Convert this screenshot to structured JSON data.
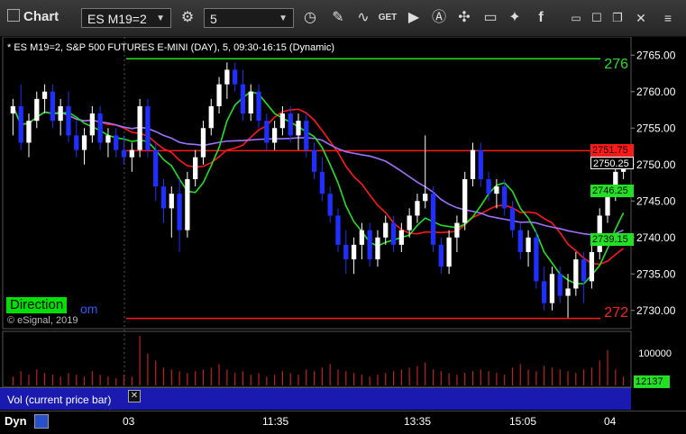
{
  "toolbar": {
    "title": "Chart",
    "symbol": "ES M19=2",
    "interval": "5"
  },
  "chart": {
    "header": "* ES M19=2, S&P 500 FUTURES E-MINI (DAY), 5, 09:30-16:15 (Dynamic)",
    "price_ticks": [
      "2765.00",
      "2760.00",
      "2755.00",
      "2750.00",
      "2745.00",
      "2740.00",
      "2735.00",
      "2730.00"
    ],
    "level_top_label": "276",
    "level_bottom_label": "272",
    "box_red_upper": "2751.75",
    "box_last": "2750.25",
    "box_green_mid": "2746.25",
    "box_green_low": "2739.15",
    "direction_label": "Direction",
    "watermark_suffix": "om",
    "copyright": "© eSignal, 2019",
    "volume_tick": "100000",
    "volume_last": "12137",
    "volume_label": "Vol (current price bar)",
    "x_ticks": [
      "03",
      "11:35",
      "13:35",
      "15:05",
      "04"
    ],
    "footer_mode": "Dyn",
    "colors": {
      "up": "#ffffff",
      "down": "#1f2fff",
      "ma_red": "#ff1a1a",
      "ma_green": "#22e022",
      "ma_purple": "#a070ff",
      "accent": "#00e000"
    }
  },
  "chart_data": {
    "type": "candlestick",
    "ylim": [
      2727.5,
      2767.5
    ],
    "candles": [
      [
        2757,
        2759,
        2754,
        2758
      ],
      [
        2758,
        2761,
        2752,
        2753
      ],
      [
        2753,
        2757,
        2751,
        2756
      ],
      [
        2756,
        2760,
        2755,
        2759
      ],
      [
        2759,
        2761,
        2757,
        2760
      ],
      [
        2760,
        2761,
        2755,
        2756
      ],
      [
        2756,
        2759,
        2754,
        2758
      ],
      [
        2758,
        2760,
        2753,
        2754
      ],
      [
        2754,
        2756,
        2751,
        2752
      ],
      [
        2752,
        2755,
        2750,
        2754
      ],
      [
        2754,
        2758,
        2753,
        2757
      ],
      [
        2757,
        2758,
        2752,
        2753
      ],
      [
        2753,
        2755,
        2751,
        2754
      ],
      [
        2754,
        2755,
        2751,
        2752
      ],
      [
        2752,
        2754,
        2750,
        2751
      ],
      [
        2751,
        2753,
        2749,
        2752
      ],
      [
        2752,
        2759,
        2751,
        2758
      ],
      [
        2758,
        2759,
        2751,
        2752
      ],
      [
        2752,
        2753,
        2745,
        2747
      ],
      [
        2747,
        2748,
        2742,
        2744
      ],
      [
        2744,
        2747,
        2740,
        2746
      ],
      [
        2746,
        2748,
        2738,
        2741
      ],
      [
        2741,
        2749,
        2740,
        2748
      ],
      [
        2748,
        2752,
        2747,
        2751
      ],
      [
        2751,
        2756,
        2750,
        2755
      ],
      [
        2755,
        2759,
        2754,
        2758
      ],
      [
        2758,
        2762,
        2757,
        2761
      ],
      [
        2761,
        2764,
        2759,
        2763
      ],
      [
        2763,
        2764,
        2760,
        2761
      ],
      [
        2761,
        2763,
        2756,
        2757
      ],
      [
        2757,
        2761,
        2756,
        2760
      ],
      [
        2760,
        2761,
        2755,
        2756
      ],
      [
        2756,
        2757,
        2752,
        2753
      ],
      [
        2753,
        2756,
        2752,
        2755
      ],
      [
        2755,
        2758,
        2754,
        2757
      ],
      [
        2757,
        2758,
        2753,
        2754
      ],
      [
        2754,
        2757,
        2752,
        2756
      ],
      [
        2756,
        2757,
        2751,
        2752
      ],
      [
        2752,
        2753,
        2748,
        2749
      ],
      [
        2749,
        2751,
        2745,
        2746
      ],
      [
        2746,
        2747,
        2742,
        2743
      ],
      [
        2743,
        2744,
        2738,
        2739
      ],
      [
        2739,
        2741,
        2735,
        2737
      ],
      [
        2737,
        2740,
        2735,
        2739
      ],
      [
        2739,
        2742,
        2737,
        2741
      ],
      [
        2741,
        2742,
        2736,
        2737
      ],
      [
        2737,
        2741,
        2736,
        2740
      ],
      [
        2740,
        2743,
        2739,
        2742
      ],
      [
        2742,
        2743,
        2738,
        2739
      ],
      [
        2739,
        2742,
        2738,
        2741
      ],
      [
        2741,
        2744,
        2740,
        2743
      ],
      [
        2743,
        2746,
        2742,
        2745
      ],
      [
        2745,
        2754,
        2744,
        2746
      ],
      [
        2746,
        2747,
        2738,
        2739
      ],
      [
        2739,
        2740,
        2735,
        2736
      ],
      [
        2736,
        2741,
        2735,
        2740
      ],
      [
        2740,
        2743,
        2738,
        2742
      ],
      [
        2742,
        2749,
        2741,
        2748
      ],
      [
        2748,
        2753,
        2747,
        2752
      ],
      [
        2752,
        2753,
        2747,
        2748
      ],
      [
        2748,
        2749,
        2745,
        2746
      ],
      [
        2746,
        2748,
        2744,
        2747
      ],
      [
        2747,
        2748,
        2743,
        2744
      ],
      [
        2744,
        2745,
        2740,
        2741
      ],
      [
        2741,
        2742,
        2737,
        2738
      ],
      [
        2738,
        2741,
        2736,
        2740
      ],
      [
        2740,
        2741,
        2733,
        2734
      ],
      [
        2734,
        2736,
        2730,
        2731
      ],
      [
        2731,
        2736,
        2730,
        2735
      ],
      [
        2735,
        2736,
        2731,
        2732
      ],
      [
        2732,
        2735,
        2729,
        2733
      ],
      [
        2733,
        2738,
        2732,
        2737
      ],
      [
        2737,
        2738,
        2731,
        2734
      ],
      [
        2734,
        2739,
        2733,
        2738
      ],
      [
        2738,
        2744,
        2737,
        2743
      ],
      [
        2743,
        2747,
        2742,
        2746
      ],
      [
        2746,
        2750,
        2745,
        2749
      ],
      [
        2749,
        2751,
        2748,
        2750.25
      ]
    ],
    "volume": [
      5,
      8,
      6,
      9,
      7,
      6,
      5,
      7,
      6,
      5,
      8,
      6,
      5,
      4,
      6,
      5,
      28,
      18,
      14,
      10,
      9,
      8,
      7,
      8,
      9,
      10,
      12,
      9,
      7,
      8,
      6,
      7,
      5,
      6,
      8,
      7,
      6,
      9,
      8,
      10,
      12,
      9,
      8,
      7,
      6,
      5,
      6,
      7,
      8,
      9,
      10,
      11,
      13,
      9,
      8,
      7,
      6,
      7,
      8,
      9,
      8,
      7,
      6,
      10,
      12,
      9,
      8,
      11,
      10,
      9,
      8,
      7,
      9,
      10,
      14,
      20,
      9,
      5
    ],
    "horizontal_levels": [
      {
        "value": 2764.5,
        "color": "green"
      },
      {
        "value": 2751.9,
        "color": "red"
      },
      {
        "value": 2728.9,
        "color": "red"
      }
    ]
  }
}
